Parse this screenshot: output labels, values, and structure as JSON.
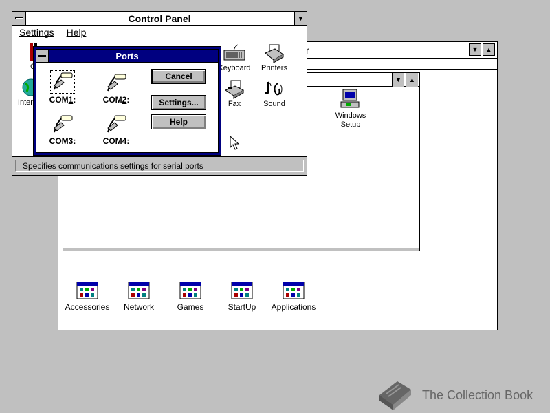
{
  "program_manager": {
    "title_fragment": "r",
    "groups": [
      {
        "label": "Accessories"
      },
      {
        "label": "Network"
      },
      {
        "label": "Games"
      },
      {
        "label": "StartUp"
      },
      {
        "label": "Applications"
      }
    ],
    "inner_group": {
      "icons": [
        {
          "label": "Windows\nSetup"
        }
      ]
    }
  },
  "control_panel": {
    "title": "Control Panel",
    "menu": {
      "settings": "Settings",
      "help": "Help"
    },
    "icons": {
      "color_partial": "Co",
      "internet_partial": "Intern",
      "keyboard": "Keyboard",
      "printers": "Printers",
      "fax": "Fax",
      "sound": "Sound"
    },
    "status": "Specifies communications settings for serial ports"
  },
  "ports_dialog": {
    "title": "Ports",
    "ports": [
      {
        "pre": "COM",
        "num": "1",
        "suffix": ":"
      },
      {
        "pre": "COM",
        "num": "2",
        "suffix": ":"
      },
      {
        "pre": "COM",
        "num": "3",
        "suffix": ":"
      },
      {
        "pre": "COM",
        "num": "4",
        "suffix": ":"
      }
    ],
    "buttons": {
      "cancel": "Cancel",
      "settings": "Settings...",
      "help": "Help"
    }
  },
  "watermark": {
    "text": "The Collection Book"
  },
  "colors": {
    "dialog_frame": "#000080",
    "desktop": "#c0c0c0"
  }
}
